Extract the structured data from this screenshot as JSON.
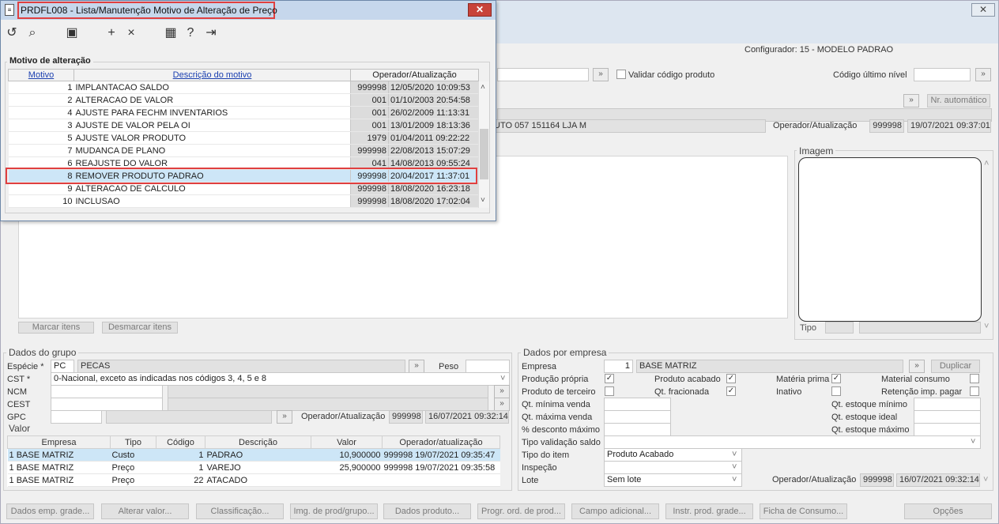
{
  "dialog": {
    "title": "PRDFL008 - Lista/Manutenção Motivo de Alteração de Preço",
    "close_label": "✕",
    "section_title": "Motivo de alteração",
    "columns": {
      "motivo": "Motivo",
      "descricao": "Descrição do motivo",
      "operador": "Operador/Atualização"
    },
    "rows": [
      {
        "motivo": "1",
        "descricao": "IMPLANTACAO SALDO",
        "operador": "999998",
        "data": "12/05/2020 10:09:53"
      },
      {
        "motivo": "2",
        "descricao": "ALTERACAO DE VALOR",
        "operador": "001",
        "data": "01/10/2003 20:54:58"
      },
      {
        "motivo": "4",
        "descricao": "AJUSTE PARA FECHM INVENTARIOS",
        "operador": "001",
        "data": "26/02/2009 11:13:31"
      },
      {
        "motivo": "3",
        "descricao": "AJUSTE DE VALOR PELA OI",
        "operador": "001",
        "data": "13/01/2009 18:13:36"
      },
      {
        "motivo": "5",
        "descricao": "AJUSTE VALOR PRODUTO",
        "operador": "1979",
        "data": "01/04/2011 09:22:22"
      },
      {
        "motivo": "7",
        "descricao": "MUDANCA DE PLANO",
        "operador": "999998",
        "data": "22/08/2013 15:07:29"
      },
      {
        "motivo": "6",
        "descricao": "REAJUSTE DO VALOR",
        "operador": "041",
        "data": "14/08/2013 09:55:24"
      },
      {
        "motivo": "8",
        "descricao": "REMOVER PRODUTO PADRAO",
        "operador": "999998",
        "data": "20/04/2017 11:37:01"
      },
      {
        "motivo": "9",
        "descricao": "ALTERACAO DE CALCULO",
        "operador": "999998",
        "data": "18/08/2020 16:23:18"
      },
      {
        "motivo": "10",
        "descricao": "INCLUSAO",
        "operador": "999998",
        "data": "18/08/2020 17:02:04"
      }
    ],
    "selected_index": 7
  },
  "main": {
    "close_label": "✕",
    "configurador": "Configurador: 15 - MODELO PADRAO",
    "validar_label": "Validar código produto",
    "codigo_ultimo_nivel_label": "Código último nível",
    "nr_automatico_label": "Nr. automático",
    "produto_desc": "UTO 057 151164 LJA M",
    "operador_label": "Operador/Atualização",
    "operador_code": "999998",
    "operador_date": "19/07/2021 09:37:01",
    "imagem_label": "Imagem",
    "tipo_label": "Tipo",
    "marcar_label": "Marcar itens",
    "desmarcar_label": "Desmarcar itens"
  },
  "grupo": {
    "title": "Dados do grupo",
    "especie_label": "Espécie *",
    "especie_code": "PC",
    "especie_desc": "PECAS",
    "peso_label": "Peso",
    "cst_label": "CST *",
    "cst_value": "0-Nacional, exceto as indicadas nos códigos 3, 4, 5 e 8",
    "ncm_label": "NCM",
    "cest_label": "CEST",
    "gpc_label": "GPC",
    "operador_label": "Operador/Atualização",
    "operador_code": "999998",
    "operador_date": "16/07/2021 09:32:14"
  },
  "valor": {
    "title": "Valor",
    "columns": [
      "Empresa",
      "Tipo",
      "Código",
      "Descrição",
      "Valor",
      "Operador/atualização"
    ],
    "rows": [
      {
        "emp_num": "1",
        "empresa": "BASE MATRIZ",
        "tipo": "Custo",
        "codigo": "1",
        "descricao": "PADRAO",
        "valor": "10,900000",
        "operador": "999998",
        "data": "19/07/2021 09:35:47"
      },
      {
        "emp_num": "1",
        "empresa": "BASE MATRIZ",
        "tipo": "Preço",
        "codigo": "1",
        "descricao": "VAREJO",
        "valor": "25,900000",
        "operador": "999998",
        "data": "19/07/2021 09:35:58"
      },
      {
        "emp_num": "1",
        "empresa": "BASE MATRIZ",
        "tipo": "Preço",
        "codigo": "22",
        "descricao": "ATACADO",
        "valor": "",
        "operador": "",
        "data": ""
      }
    ]
  },
  "empresa": {
    "title": "Dados por empresa",
    "empresa_label": "Empresa",
    "empresa_code": "1",
    "empresa_desc": "BASE MATRIZ",
    "duplicar_label": "Duplicar",
    "producao_propria": "Produção própria",
    "produto_acabado": "Produto acabado",
    "materia_prima": "Matéria prima",
    "material_consumo": "Material consumo",
    "produto_terceiro": "Produto de terceiro",
    "qt_fracionada": "Qt. fracionada",
    "inativo": "Inativo",
    "retencao": "Retenção imp. pagar",
    "qt_min_venda": "Qt. mínima venda",
    "qt_max_venda": "Qt. máxima venda",
    "pct_desconto": "% desconto máximo",
    "qt_est_min": "Qt. estoque mínimo",
    "qt_est_ideal": "Qt. estoque ideal",
    "qt_est_max": "Qt. estoque máximo",
    "tipo_validacao": "Tipo validação saldo",
    "tipo_item_label": "Tipo do item",
    "tipo_item_value": "Produto Acabado",
    "inspecao_label": "Inspeção",
    "lote_label": "Lote",
    "lote_value": "Sem lote",
    "operador_label": "Operador/Atualização",
    "operador_code": "999998",
    "operador_date": "16/07/2021 09:32:14"
  },
  "bottom_buttons": [
    "Dados emp. grade...",
    "Alterar valor...",
    "Classificação...",
    "Img. de prod/grupo...",
    "Dados produto...",
    "Progr. ord. de prod...",
    "Campo adicional...",
    "Instr. prod. grade...",
    "Ficha de Consumo...",
    "Opções"
  ],
  "colors": {
    "highlight": "#e04040",
    "selection": "#cde6f7",
    "title_bar": "#c6d7ec"
  }
}
